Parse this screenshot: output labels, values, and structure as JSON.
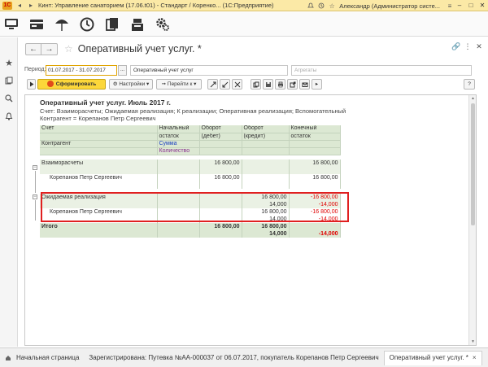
{
  "titlebar": {
    "title": "Кинт: Управление санаторием (17.06.t01) - Стандарт / Коренко... (1С:Предприятие)",
    "user": "Александр (Администратор систе..."
  },
  "section_icons": [
    "desktop-icon",
    "card-icon",
    "beach-umbrella-icon",
    "clock-icon",
    "documents-icon",
    "cash-register-icon",
    "settings-icon"
  ],
  "left_icons": [
    "favorites-star-icon",
    "history-icon",
    "search-icon",
    "bell-icon"
  ],
  "form": {
    "title": "Оперативный учет услуг. *",
    "period_label": "Период:",
    "period_value": "01.07.2017 - 31.07.2017",
    "period_pick": "...",
    "variant_value": "Оперативный учет услуг",
    "group_placeholder": "Агрегаты",
    "buttons": {
      "generate": "Сформировать",
      "settings": "Настройки",
      "goto": "Перейти к",
      "help": "?"
    }
  },
  "report": {
    "title": "Оперативный учет услуг. Июль 2017 г.",
    "filter_line_1": "Счет: Взаиморасчеты; Ожидаемая реализация; К реализации; Оперативная реализация; Вспомогательный",
    "filter_line_2": "Контрагент = Корепанов Петр Сергеевич",
    "headers": {
      "account": "Счет",
      "counterparty": "Контрагент",
      "start1": "Начальный",
      "start2": "остаток",
      "debit1": "Оборот",
      "debit2": "(дебет)",
      "credit1": "Оборот",
      "credit2": "(кредит)",
      "end1": "Конечный",
      "end2": "остаток",
      "sum": "Сумма",
      "qty": "Количество"
    },
    "rows": {
      "vz_name": "Взаиморасчеты",
      "vz_debit": "16 800,00",
      "vz_end": "16 800,00",
      "vz_k_name": "Корепанов Петр Сергеевич",
      "vz_k_debit": "16 800,00",
      "vz_k_end": "16 800,00",
      "oz_name": "Ожидаемая реализация",
      "oz_credit_sum": "16 800,00",
      "oz_end_sum": "-16 800,00",
      "oz_credit_qty": "14,000",
      "oz_end_qty": "-14,000",
      "oz_k_name": "Корепанов Петр Сергеевич",
      "oz_k_credit_sum": "16 800,00",
      "oz_k_end_sum": "-16 800,00",
      "oz_k_credit_qty": "14,000",
      "oz_k_end_qty": "-14,000",
      "total_name": "Итого",
      "total_debit": "16 800,00",
      "total_credit_sum": "16 800,00",
      "total_credit_qty": "14,000",
      "total_end_qty": "-14,000"
    }
  },
  "tabs": {
    "home": "Начальная страница",
    "doc": "Зарегистрирована: Путевка №АА-000037 от 06.07.2017, покупатель Корепанов Петр Сергеевич",
    "report": "Оперативный учет услуг. *",
    "close": "×"
  },
  "colors": {
    "titlebar": "#fbe9a6",
    "generate_button": "#fcd73a",
    "header_green": "#dce8d3",
    "group_green": "#eaf1e4",
    "negative": "#e00000",
    "highlight": "#e02020"
  }
}
